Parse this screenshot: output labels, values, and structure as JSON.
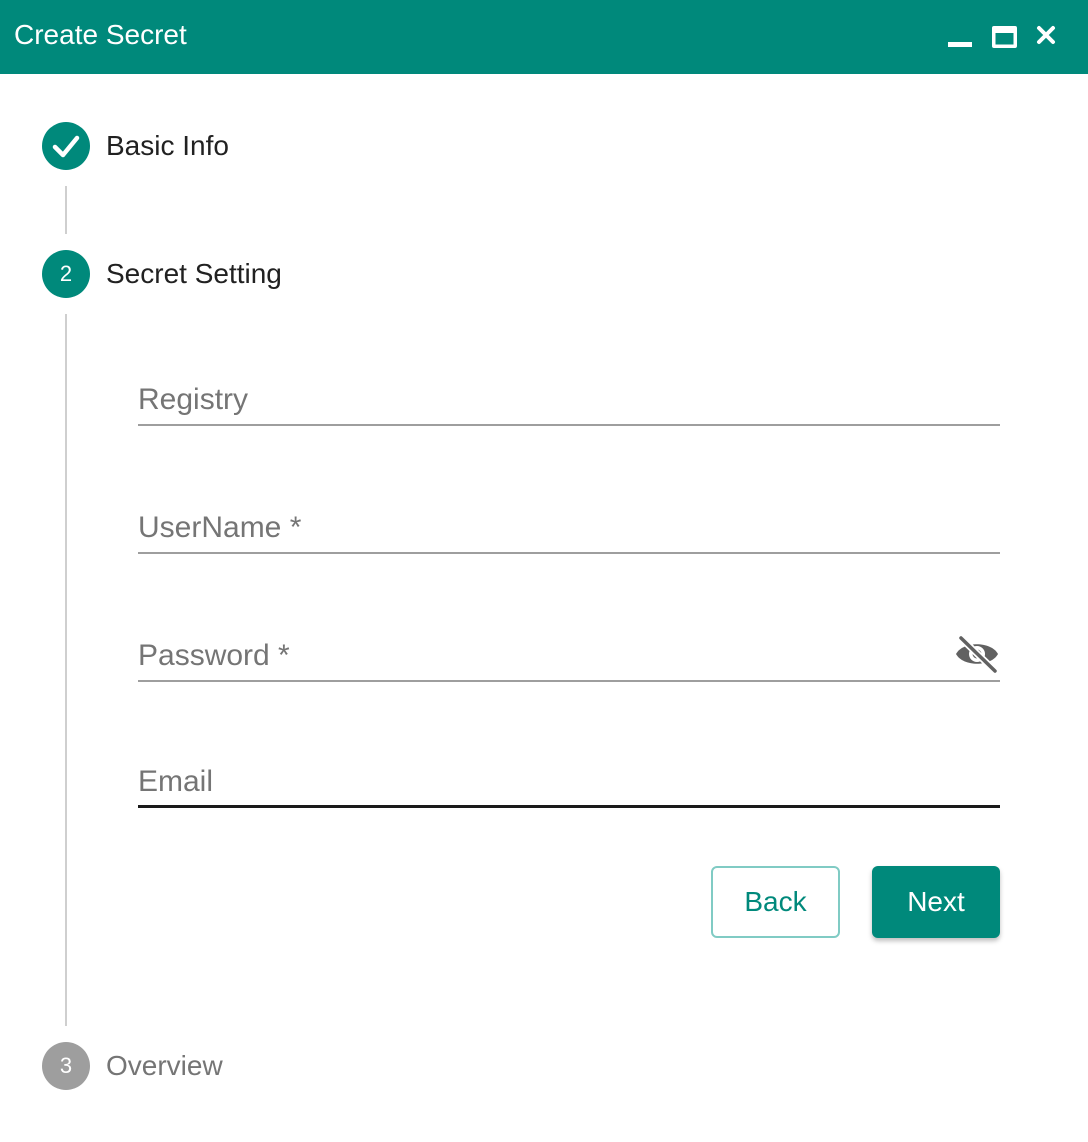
{
  "dialog": {
    "title": "Create Secret"
  },
  "steps": [
    {
      "number": "",
      "label": "Basic Info",
      "status": "done"
    },
    {
      "number": "2",
      "label": "Secret Setting",
      "status": "active"
    },
    {
      "number": "3",
      "label": "Overview",
      "status": "pending"
    }
  ],
  "form": {
    "registry": {
      "placeholder": "Registry",
      "value": ""
    },
    "username": {
      "placeholder": "UserName *",
      "value": ""
    },
    "password": {
      "placeholder": "Password *",
      "value": ""
    },
    "email": {
      "placeholder": "Email",
      "value": ""
    }
  },
  "buttons": {
    "back_label": "Back",
    "next_label": "Next"
  },
  "colors": {
    "accent": "#00897b",
    "pending": "#9e9e9e"
  },
  "icons": {
    "minimize": "minimize-icon",
    "maximize": "maximize-icon",
    "close": "close-icon",
    "step_done": "check-icon",
    "password_toggle": "eye-off-icon"
  }
}
